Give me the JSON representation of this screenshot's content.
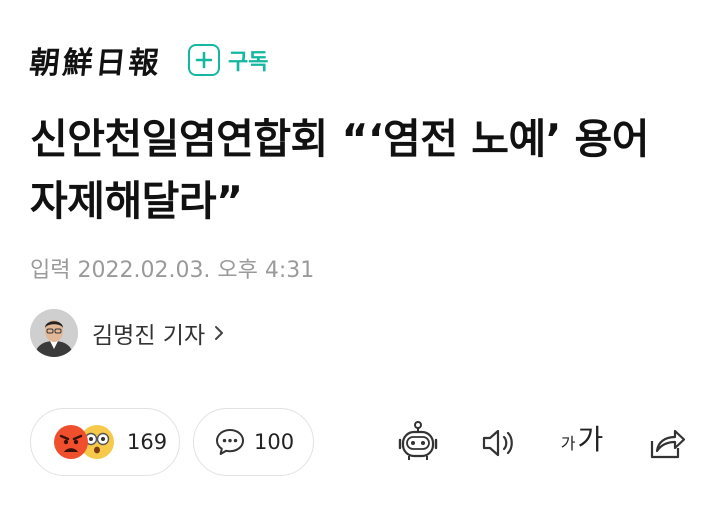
{
  "header": {
    "logo": "朝鮮日報",
    "subscribe_label": "구독"
  },
  "article": {
    "headline": "신안천일염연합회 “‘염전 노예’ 용어 자제해달라”",
    "dateline": "입력 2022.02.03. 오후 4:31",
    "author": "김명진 기자"
  },
  "reactions": {
    "count": "169",
    "icons": [
      "angry-face-icon",
      "surprised-face-icon"
    ]
  },
  "comments": {
    "count": "100"
  },
  "toolbar": {
    "font_small": "가",
    "font_large": "가"
  },
  "colors": {
    "accent": "#14b8a0",
    "meta_text": "#9a9a9a",
    "border": "#e2e2e2"
  }
}
